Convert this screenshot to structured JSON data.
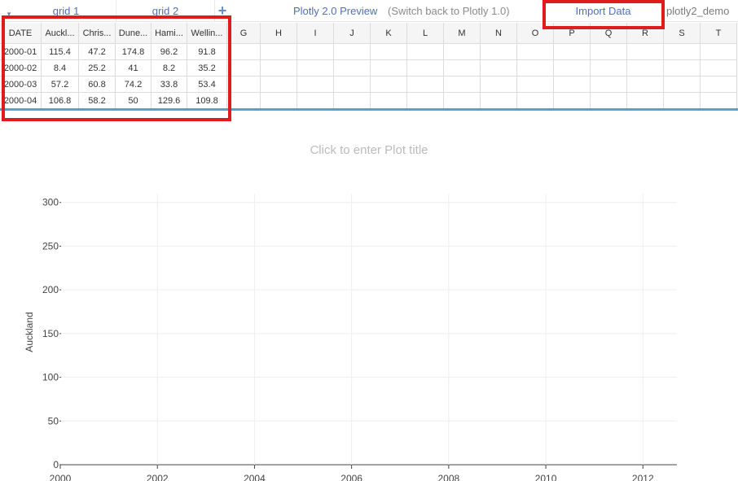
{
  "toolbar": {
    "menu_caret": "▾",
    "tabs": [
      "grid 1",
      "grid 2"
    ],
    "add_tab": "+",
    "preview_label": "Plotly 2.0 Preview",
    "switch_back": "(Switch back to Plotly 1.0)",
    "import_data": "Import Data",
    "user": "plotly2_demo"
  },
  "grid": {
    "headers": [
      "DATE",
      "Auckl...",
      "Chris...",
      "Dune...",
      "Hami...",
      "Wellin...",
      "G",
      "H",
      "I",
      "J",
      "K",
      "L",
      "M",
      "N",
      "O",
      "P",
      "Q",
      "R",
      "S",
      "T"
    ],
    "rows": [
      [
        "2000-01",
        "115.4",
        "47.2",
        "174.8",
        "96.2",
        "91.8"
      ],
      [
        "2000-02",
        "8.4",
        "25.2",
        "41",
        "8.2",
        "35.2"
      ],
      [
        "2000-03",
        "57.2",
        "60.8",
        "74.2",
        "33.8",
        "53.4"
      ],
      [
        "2000-04",
        "106.8",
        "58.2",
        "50",
        "129.6",
        "109.8"
      ]
    ]
  },
  "plot": {
    "title_placeholder": "Click to enter Plot title"
  },
  "chart_data": {
    "type": "line",
    "title": "",
    "xlabel": "",
    "ylabel": "Auckland",
    "x_ticks": [
      "2000",
      "2002",
      "2004",
      "2006",
      "2008",
      "2010",
      "2012"
    ],
    "y_ticks": [
      "0",
      "50",
      "100",
      "150",
      "200",
      "250",
      "300"
    ],
    "xlim": [
      2000,
      2012.7
    ],
    "ylim": [
      0,
      310
    ],
    "series": [],
    "grid": true,
    "colors": {
      "grid": "#eeeeee",
      "axis": "#444444"
    }
  },
  "highlight_color": "#e01b1b",
  "accent_color": "#4da3de"
}
